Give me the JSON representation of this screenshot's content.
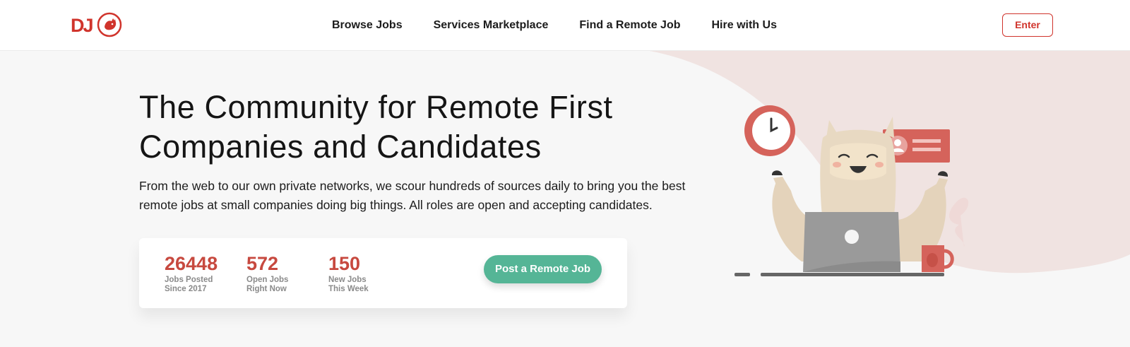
{
  "brand": {
    "logo_text": "DJ",
    "color": "#d0342c"
  },
  "nav": {
    "items": [
      {
        "label": "Browse Jobs"
      },
      {
        "label": "Services Marketplace"
      },
      {
        "label": "Find a Remote Job"
      },
      {
        "label": "Hire with Us"
      }
    ],
    "enter_label": "Enter"
  },
  "hero": {
    "title_line1": "The Community for Remote First",
    "title_line2": "Companies and Candidates",
    "description": "From the web to our own private networks, we scour hundreds of sources daily to bring you the best remote jobs at small companies doing big things. All roles are open and accepting candidates."
  },
  "stats": [
    {
      "value": "26448",
      "label_line1": "Jobs Posted",
      "label_line2": "Since 2017"
    },
    {
      "value": "572",
      "label_line1": "Open Jobs",
      "label_line2": "Right Now"
    },
    {
      "value": "150",
      "label_line1": "New Jobs",
      "label_line2": "This Week"
    }
  ],
  "cta": {
    "label": "Post a Remote Job",
    "color": "#55b596"
  },
  "illustration": {
    "name": "llama-with-laptop-illustration"
  },
  "colors": {
    "accent": "#d0342c",
    "stat_number": "#c7493f",
    "background": "#f7f7f7",
    "blob": "#f0e3e1"
  }
}
